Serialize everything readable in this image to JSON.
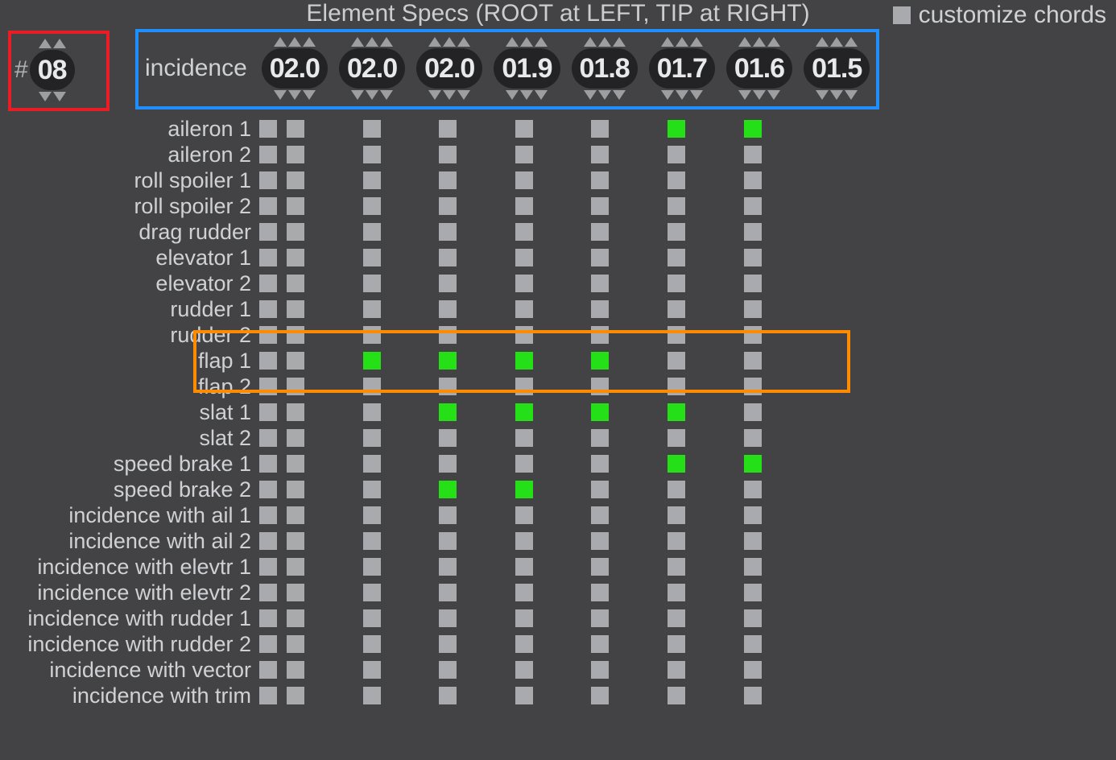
{
  "title": "Element Specs (ROOT at LEFT, TIP at RIGHT)",
  "customize_label": "customize chords",
  "customize_checked": false,
  "hash_label": "#",
  "count_value": "08",
  "incidence_label": "incidence",
  "incidence_values": [
    "02.0",
    "02.0",
    "02.0",
    "01.9",
    "01.8",
    "01.7",
    "01.6",
    "01.5"
  ],
  "segments": 8,
  "rows": [
    {
      "label": "aileron 1",
      "cells": [
        0,
        0,
        0,
        0,
        0,
        0,
        1,
        1
      ]
    },
    {
      "label": "aileron 2",
      "cells": [
        0,
        0,
        0,
        0,
        0,
        0,
        0,
        0
      ]
    },
    {
      "label": "roll spoiler 1",
      "cells": [
        0,
        0,
        0,
        0,
        0,
        0,
        0,
        0
      ]
    },
    {
      "label": "roll spoiler 2",
      "cells": [
        0,
        0,
        0,
        0,
        0,
        0,
        0,
        0
      ]
    },
    {
      "label": "drag rudder",
      "cells": [
        0,
        0,
        0,
        0,
        0,
        0,
        0,
        0
      ]
    },
    {
      "label": "elevator 1",
      "cells": [
        0,
        0,
        0,
        0,
        0,
        0,
        0,
        0
      ]
    },
    {
      "label": "elevator 2",
      "cells": [
        0,
        0,
        0,
        0,
        0,
        0,
        0,
        0
      ]
    },
    {
      "label": "rudder 1",
      "cells": [
        0,
        0,
        0,
        0,
        0,
        0,
        0,
        0
      ]
    },
    {
      "label": "rudder 2",
      "cells": [
        0,
        0,
        0,
        0,
        0,
        0,
        0,
        0
      ]
    },
    {
      "label": "flap 1",
      "cells": [
        0,
        0,
        1,
        1,
        1,
        1,
        0,
        0
      ]
    },
    {
      "label": "flap 2",
      "cells": [
        0,
        0,
        0,
        0,
        0,
        0,
        0,
        0
      ]
    },
    {
      "label": "slat 1",
      "cells": [
        0,
        0,
        0,
        1,
        1,
        1,
        1,
        0
      ]
    },
    {
      "label": "slat 2",
      "cells": [
        0,
        0,
        0,
        0,
        0,
        0,
        0,
        0
      ]
    },
    {
      "label": "speed brake 1",
      "cells": [
        0,
        0,
        0,
        0,
        0,
        0,
        1,
        1
      ]
    },
    {
      "label": "speed brake 2",
      "cells": [
        0,
        0,
        0,
        1,
        1,
        0,
        0,
        0
      ]
    },
    {
      "label": "incidence with ail 1",
      "cells": [
        0,
        0,
        0,
        0,
        0,
        0,
        0,
        0
      ]
    },
    {
      "label": "incidence with ail 2",
      "cells": [
        0,
        0,
        0,
        0,
        0,
        0,
        0,
        0
      ]
    },
    {
      "label": "incidence with elevtr 1",
      "cells": [
        0,
        0,
        0,
        0,
        0,
        0,
        0,
        0
      ]
    },
    {
      "label": "incidence with elevtr 2",
      "cells": [
        0,
        0,
        0,
        0,
        0,
        0,
        0,
        0
      ]
    },
    {
      "label": "incidence with rudder 1",
      "cells": [
        0,
        0,
        0,
        0,
        0,
        0,
        0,
        0
      ]
    },
    {
      "label": "incidence with rudder 2",
      "cells": [
        0,
        0,
        0,
        0,
        0,
        0,
        0,
        0
      ]
    },
    {
      "label": "incidence with vector",
      "cells": [
        0,
        0,
        0,
        0,
        0,
        0,
        0,
        0
      ]
    },
    {
      "label": "incidence with trim",
      "cells": [
        0,
        0,
        0,
        0,
        0,
        0,
        0,
        0
      ]
    }
  ],
  "highlights": {
    "red": "count",
    "blue": "incidence",
    "orange_row_index": 9
  }
}
